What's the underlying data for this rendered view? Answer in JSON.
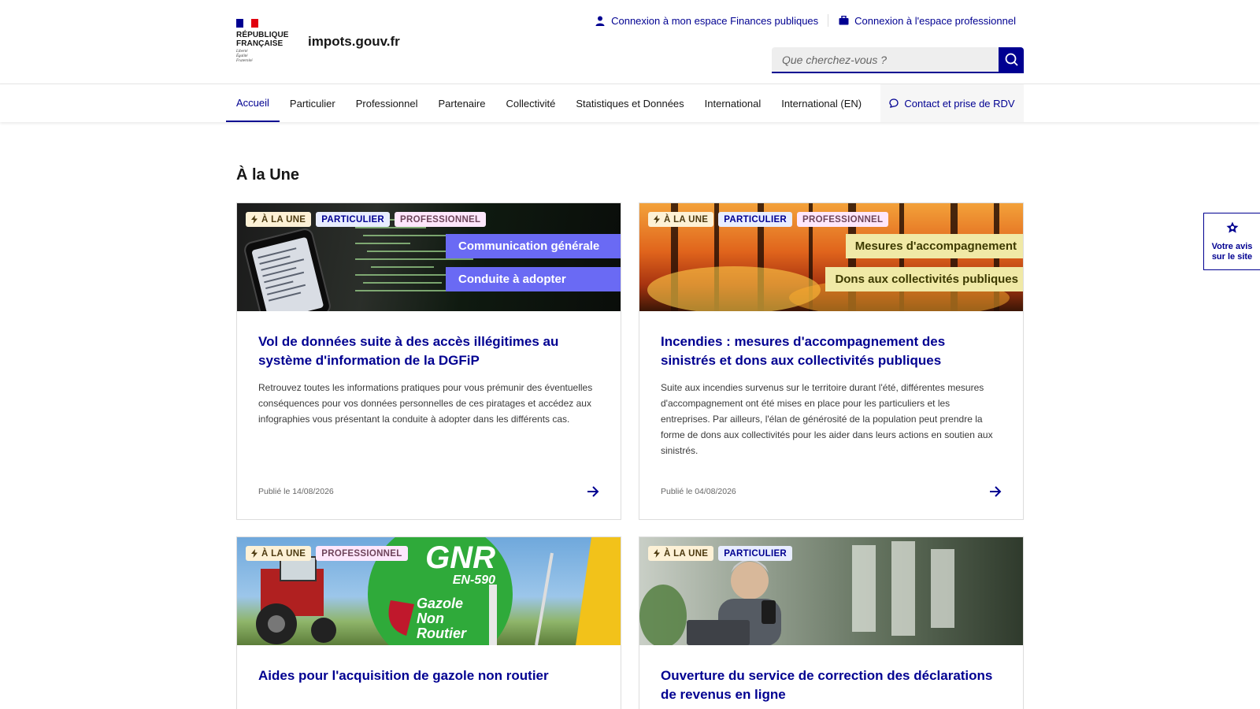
{
  "header": {
    "republic_line1": "RÉPUBLIQUE",
    "republic_line2": "FRANÇAISE",
    "motto_line1": "Liberté",
    "motto_line2": "Égalité",
    "motto_line3": "Fraternité",
    "site_name": "impots.gouv.fr",
    "login_personal": "Connexion à mon espace Finances publiques",
    "login_pro": "Connexion à l'espace professionnel",
    "search_placeholder": "Que cherchez-vous ?"
  },
  "nav": {
    "items": [
      {
        "label": "Accueil",
        "active": true
      },
      {
        "label": "Particulier"
      },
      {
        "label": "Professionnel"
      },
      {
        "label": "Partenaire"
      },
      {
        "label": "Collectivité"
      },
      {
        "label": "Statistiques et Données"
      },
      {
        "label": "International"
      },
      {
        "label": "International (EN)"
      }
    ],
    "contact": "Contact et prise de RDV"
  },
  "main": {
    "section_title": "À la Une",
    "badges": {
      "une": "À LA UNE",
      "particulier": "PARTICULIER",
      "professionnel": "PROFESSIONNEL"
    },
    "cards": [
      {
        "img_labels": [
          "Communication générale",
          "Conduite à adopter"
        ],
        "title": "Vol de données suite à des accès illégitimes au système d'information de la DGFiP",
        "desc": "Retrouvez toutes les informations pratiques pour vous prémunir des éventuelles conséquences pour vos données personnelles de ces piratages et accédez aux infographies vous présentant la conduite à adopter dans les différents cas.",
        "date": "Publié le 14/08/2026"
      },
      {
        "img_labels": [
          "Mesures d'accompagnement",
          "Dons aux collectivités publiques"
        ],
        "title": "Incendies : mesures d'accompagnement des sinistrés et dons aux collectivités publiques",
        "desc": "Suite aux incendies survenus sur le territoire durant l'été, différentes mesures d'accompagnement ont été mises en place pour les particuliers et les entreprises. Par ailleurs, l'élan de générosité de la population peut prendre la forme de dons aux collectivités pour les aider dans leurs actions en soutien aux sinistrés.",
        "date": "Publié le 04/08/2026"
      },
      {
        "img_text": {
          "gnr": "GNR",
          "norm": "EN-590",
          "line1": "Gazole",
          "line2": "Non",
          "line3": "Routier"
        },
        "title": "Aides pour l'acquisition de gazole non routier"
      },
      {
        "title": "Ouverture du service de correction des déclarations de revenus en ligne"
      }
    ]
  },
  "feedback": {
    "line1": "Votre avis",
    "line2": "sur le site"
  },
  "colors": {
    "brand_blue": "#000091",
    "flag_blue": "#000091",
    "flag_red": "#e1000f",
    "label_blue": "#6a6af4",
    "label_yellow": "#f0e9a6"
  }
}
